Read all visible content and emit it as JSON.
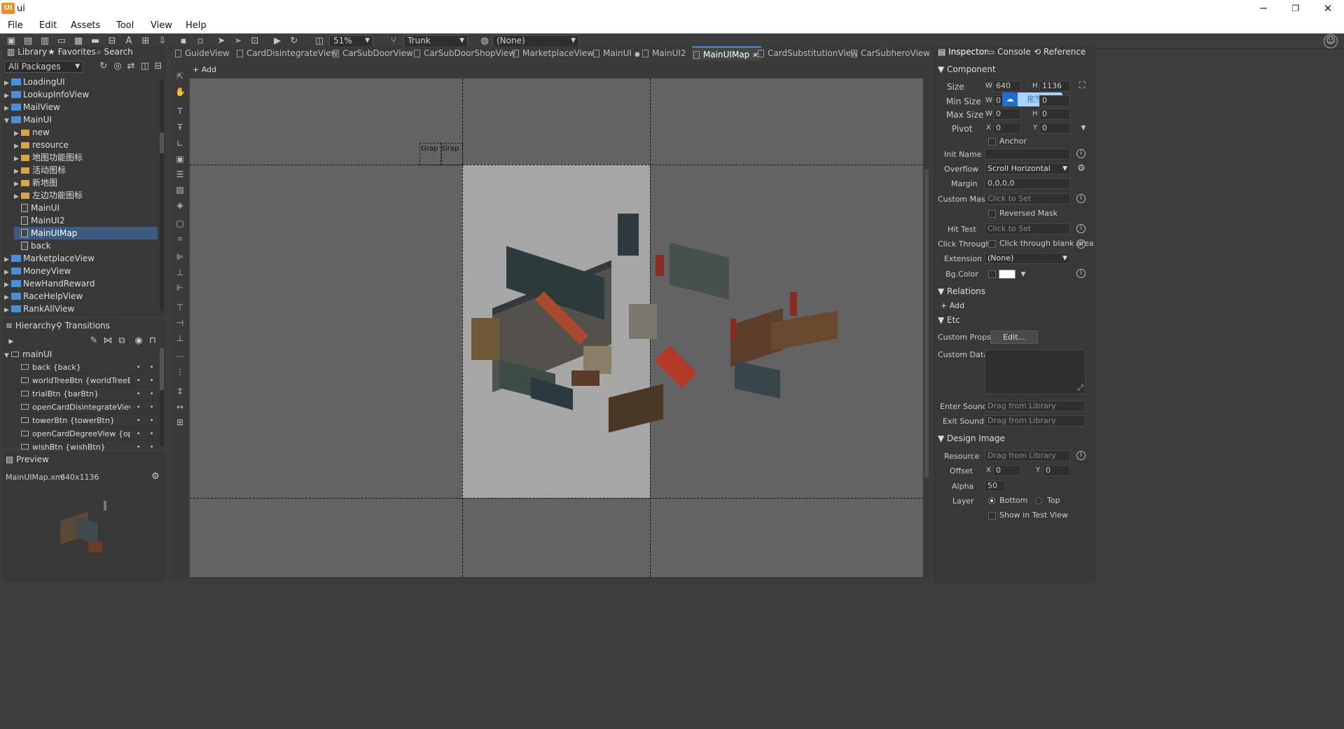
{
  "window": {
    "title": "ui",
    "logo": "UI",
    "min": "─",
    "restore": "❐",
    "close": "✕"
  },
  "menu": [
    "File",
    "Edit",
    "Assets",
    "Tool",
    "View",
    "Help"
  ],
  "toolbar": {
    "zoom": "51%",
    "branch": "Trunk",
    "language": "(None)"
  },
  "library": {
    "tabs": [
      "Library",
      "Favorites",
      "Search"
    ],
    "package_filter": "All Packages",
    "tree": [
      {
        "label": "LoadingUI",
        "level": 0,
        "type": "pkg",
        "exp": "▶"
      },
      {
        "label": "LookupInfoView",
        "level": 0,
        "type": "pkg",
        "exp": "▶"
      },
      {
        "label": "MailView",
        "level": 0,
        "type": "pkg",
        "exp": "▶"
      },
      {
        "label": "MainUI",
        "level": 0,
        "type": "pkg",
        "exp": "▼"
      },
      {
        "label": "new",
        "level": 1,
        "type": "folder",
        "exp": "▶"
      },
      {
        "label": "resource",
        "level": 1,
        "type": "folder",
        "exp": "▶"
      },
      {
        "label": "地图功能图标",
        "level": 1,
        "type": "folder",
        "exp": "▶"
      },
      {
        "label": "活动图标",
        "level": 1,
        "type": "folder",
        "exp": "▶"
      },
      {
        "label": "新地图",
        "level": 1,
        "type": "folder",
        "exp": "▶"
      },
      {
        "label": "左边功能图标",
        "level": 1,
        "type": "folder",
        "exp": "▶"
      },
      {
        "label": "MainUI",
        "level": 1,
        "type": "file",
        "exp": ""
      },
      {
        "label": "MainUI2",
        "level": 1,
        "type": "file",
        "exp": ""
      },
      {
        "label": "MainUIMap",
        "level": 1,
        "type": "file",
        "exp": "",
        "selected": true
      },
      {
        "label": "back",
        "level": 1,
        "type": "file",
        "exp": ""
      },
      {
        "label": "MarketplaceView",
        "level": 0,
        "type": "pkg",
        "exp": "▶"
      },
      {
        "label": "MoneyView",
        "level": 0,
        "type": "pkg",
        "exp": "▶"
      },
      {
        "label": "NewHandReward",
        "level": 0,
        "type": "pkg",
        "exp": "▶"
      },
      {
        "label": "RaceHelpView",
        "level": 0,
        "type": "pkg",
        "exp": "▶"
      },
      {
        "label": "RankAllView",
        "level": 0,
        "type": "pkg",
        "exp": "▶"
      }
    ]
  },
  "hierarchy": {
    "tabs": [
      "Hierarchy",
      "Transitions"
    ],
    "root": "mainUI",
    "items": [
      "back {back}",
      "worldTreeBtn {worldTreeBtn}",
      "trialBtn {barBtn}",
      "openCardDisintegrateView {c",
      "towerBtn {towerBtn}",
      "openCardDegreeView {open",
      "wishBtn {wishBtn}"
    ]
  },
  "preview": {
    "tab": "Preview",
    "file": "MainUIMap.xml",
    "size": "640x1136"
  },
  "doc_tabs": [
    {
      "label": "GuideView"
    },
    {
      "label": "CardDisintegrateView"
    },
    {
      "label": "CarSubDoorView"
    },
    {
      "label": "CarSubDoorShopView"
    },
    {
      "label": "MarketplaceView"
    },
    {
      "label": "MainUI",
      "dot": "●"
    },
    {
      "label": "MainUI2"
    },
    {
      "label": "MainUIMap",
      "active": true,
      "close": "✕"
    },
    {
      "label": "CardSubstitutionView"
    },
    {
      "label": "CarSubheroView"
    }
  ],
  "stage": {
    "add": "+ Add",
    "graph_labels": [
      "Grap",
      "Grap"
    ]
  },
  "inspector": {
    "tabs": [
      "Inspector",
      "Console",
      "Reference"
    ],
    "component": {
      "title": "Component",
      "size_label": "Size",
      "w_label": "W",
      "h_label": "H",
      "x_label": "X",
      "y_label": "Y",
      "size_w": "640",
      "size_h": "1136",
      "min_size_label": "Min Size",
      "min_w": "0",
      "min_h": "0",
      "upload_button": "拖拽上传",
      "max_size_label": "Max Size",
      "max_w": "0",
      "max_h": "0",
      "pivot_label": "Pivot",
      "pivot_x": "0",
      "pivot_y": "0",
      "anchor_label": "Anchor",
      "init_name_label": "Init Name",
      "init_name": "",
      "overflow_label": "Overflow",
      "overflow": "Scroll Horizontal",
      "margin_label": "Margin",
      "margin": "0,0,0,0",
      "custom_mask_label": "Custom Mask",
      "custom_mask": "Click to Set",
      "reversed_mask_label": "Reversed Mask",
      "hit_test_label": "Hit Test",
      "hit_test": "Click to Set",
      "click_through_label": "Click Through",
      "click_through_text": "Click through blank area",
      "extension_label": "Extension",
      "extension": "(None)",
      "bg_color_label": "Bg.Color",
      "bg_color": "#ffffff"
    },
    "relations": {
      "title": "Relations",
      "add": "+ Add"
    },
    "etc": {
      "title": "Etc",
      "custom_props_label": "Custom Props.",
      "edit_button": "Edit...",
      "custom_data_label": "Custom Data",
      "enter_sound_label": "Enter Sound",
      "enter_sound": "Drag from Library",
      "exit_sound_label": "Exit Sound",
      "exit_sound": "Drag from Library"
    },
    "design_image": {
      "title": "Design Image",
      "resource_label": "Resource",
      "resource": "Drag from Library",
      "offset_label": "Offset",
      "offset_x": "0",
      "offset_y": "0",
      "alpha_label": "Alpha",
      "alpha": "50",
      "layer_label": "Layer",
      "layer_bottom": "Bottom",
      "layer_top": "Top",
      "show_test_label": "Show in Test View"
    }
  },
  "colors": {
    "accent": "#4a90d9",
    "selected": "#3d5a80",
    "folder": "#d9a441",
    "canvas_bg": "#636363",
    "design_area": "#a6a6a6"
  }
}
